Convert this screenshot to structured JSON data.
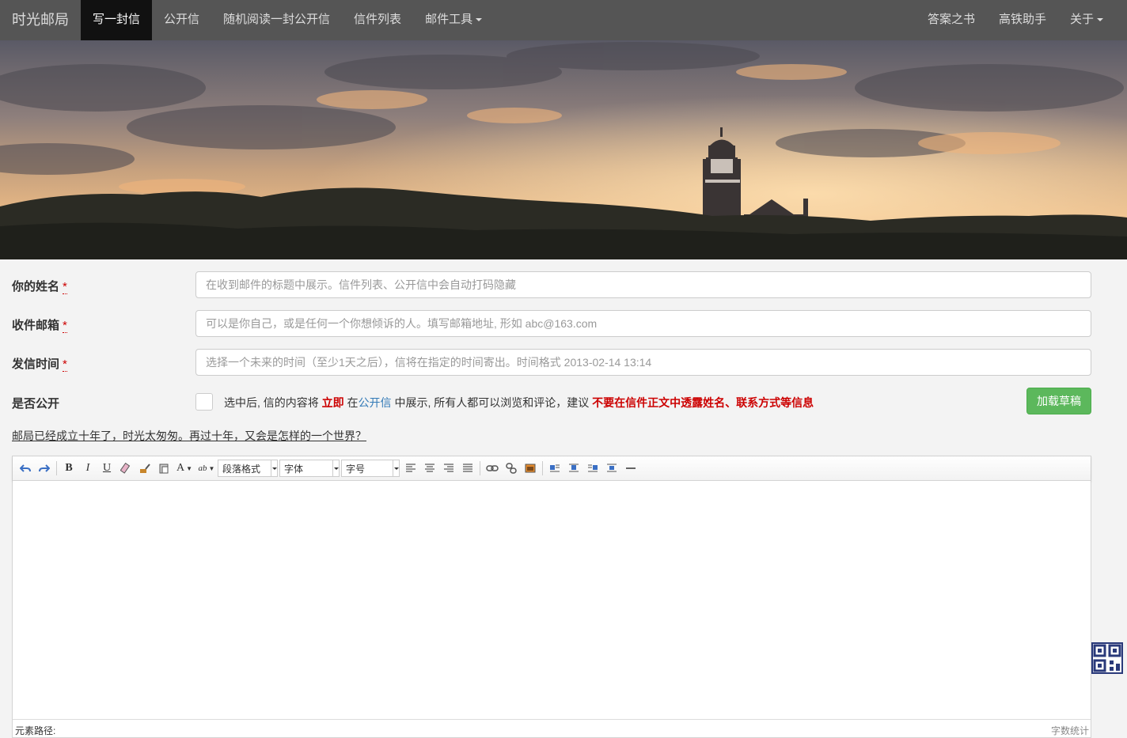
{
  "navbar": {
    "brand": "时光邮局",
    "items": [
      {
        "label": "写一封信",
        "active": true
      },
      {
        "label": "公开信"
      },
      {
        "label": "随机阅读一封公开信"
      },
      {
        "label": "信件列表"
      },
      {
        "label": "邮件工具",
        "dropdown": true
      }
    ],
    "right_items": [
      {
        "label": "答案之书"
      },
      {
        "label": "高铁助手"
      },
      {
        "label": "关于",
        "dropdown": true
      }
    ]
  },
  "form": {
    "name": {
      "label": "你的姓名",
      "required_mark": "*",
      "placeholder": "在收到邮件的标题中展示。信件列表、公开信中会自动打码隐藏"
    },
    "email": {
      "label": "收件邮箱",
      "required_mark": "*",
      "placeholder": "可以是你自己，或是任何一个你想倾诉的人。填写邮箱地址, 形如 abc@163.com"
    },
    "send_time": {
      "label": "发信时间",
      "required_mark": "*",
      "placeholder": "选择一个未来的时间（至少1天之后），信将在指定的时间寄出。时间格式 2013-02-14 13:14"
    },
    "public": {
      "label": "是否公开",
      "text_1": "选中后, 信的内容将 ",
      "text_immediately": "立即",
      "text_2": " 在",
      "text_link": "公开信",
      "text_3": " 中展示, 所有人都可以浏览和评论，建议 ",
      "text_warning": "不要在信件正文中透露姓名、联系方式等信息"
    },
    "load_draft_button": "加载草稿"
  },
  "slogan": "邮局已经成立十年了，时光太匆匆。再过十年，又会是怎样的一个世界？",
  "editor": {
    "paragraph_format": "段落格式",
    "font_family": "字体",
    "font_size": "字号",
    "element_path_label": "元素路径:",
    "word_count_label": "字数统计"
  },
  "colors": {
    "navbar_bg": "#555555",
    "active_nav_bg": "#111111",
    "primary_green": "#5cb85c",
    "warning_red": "#cc0000",
    "link_blue": "#337ab7"
  }
}
